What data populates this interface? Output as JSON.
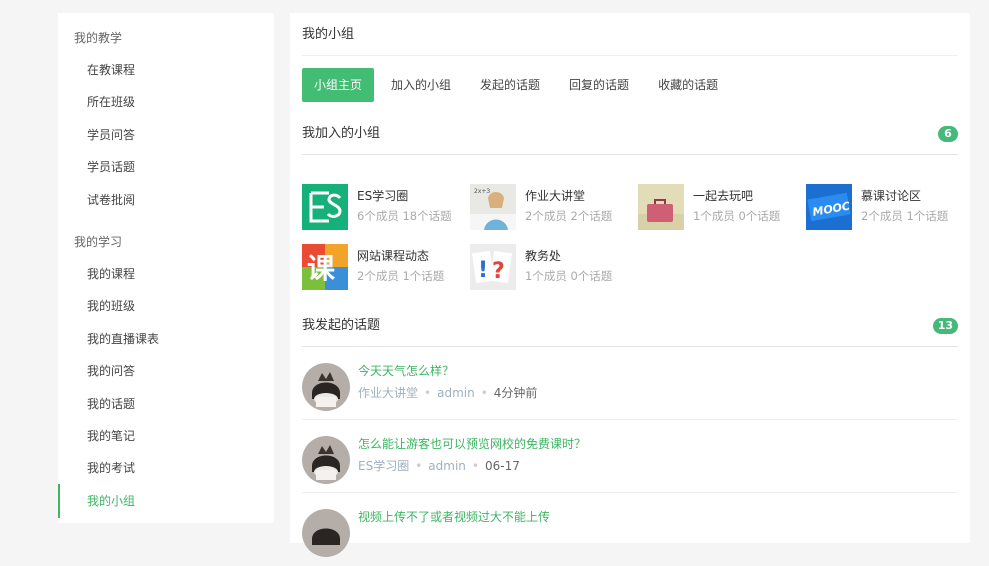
{
  "sidebar": {
    "teaching": {
      "title": "我的教学",
      "items": [
        "在教课程",
        "所在班级",
        "学员问答",
        "学员话题",
        "试卷批阅"
      ]
    },
    "learning": {
      "title": "我的学习",
      "items": [
        "我的课程",
        "我的班级",
        "我的直播课表",
        "我的问答",
        "我的话题",
        "我的笔记",
        "我的考试",
        "我的小组"
      ]
    }
  },
  "main": {
    "title": "我的小组",
    "tabs": [
      "小组主页",
      "加入的小组",
      "发起的话题",
      "回复的话题",
      "收藏的话题"
    ],
    "joined": {
      "heading": "我加入的小组",
      "count": "6",
      "groups": [
        {
          "name": "ES学习圈",
          "stats": "6个成员  18个话题",
          "icon": "es-logo-icon"
        },
        {
          "name": "作业大讲堂",
          "stats": "2个成员  2个话题",
          "icon": "student-photo-icon"
        },
        {
          "name": "一起去玩吧",
          "stats": "1个成员  0个话题",
          "icon": "suitcase-photo-icon"
        },
        {
          "name": "慕课讨论区",
          "stats": "2个成员  1个话题",
          "icon": "mooc-logo-icon"
        },
        {
          "name": "网站课程动态",
          "stats": "2个成员  1个话题",
          "icon": "course-logo-icon"
        },
        {
          "name": "教务处",
          "stats": "1个成员  0个话题",
          "icon": "question-mark-icon"
        }
      ]
    },
    "topics": {
      "heading": "我发起的话题",
      "count": "13",
      "items": [
        {
          "title": "今天天气怎么样？",
          "group": "作业大讲堂",
          "user": "admin",
          "time": "4分钟前"
        },
        {
          "title": "怎么能让游客也可以预览网校的免费课时？",
          "group": "ES学习圈",
          "user": "admin",
          "time": "06-17"
        },
        {
          "title": "视频上传不了或者视频过大不能上传",
          "group": "",
          "user": "",
          "time": ""
        }
      ]
    }
  }
}
